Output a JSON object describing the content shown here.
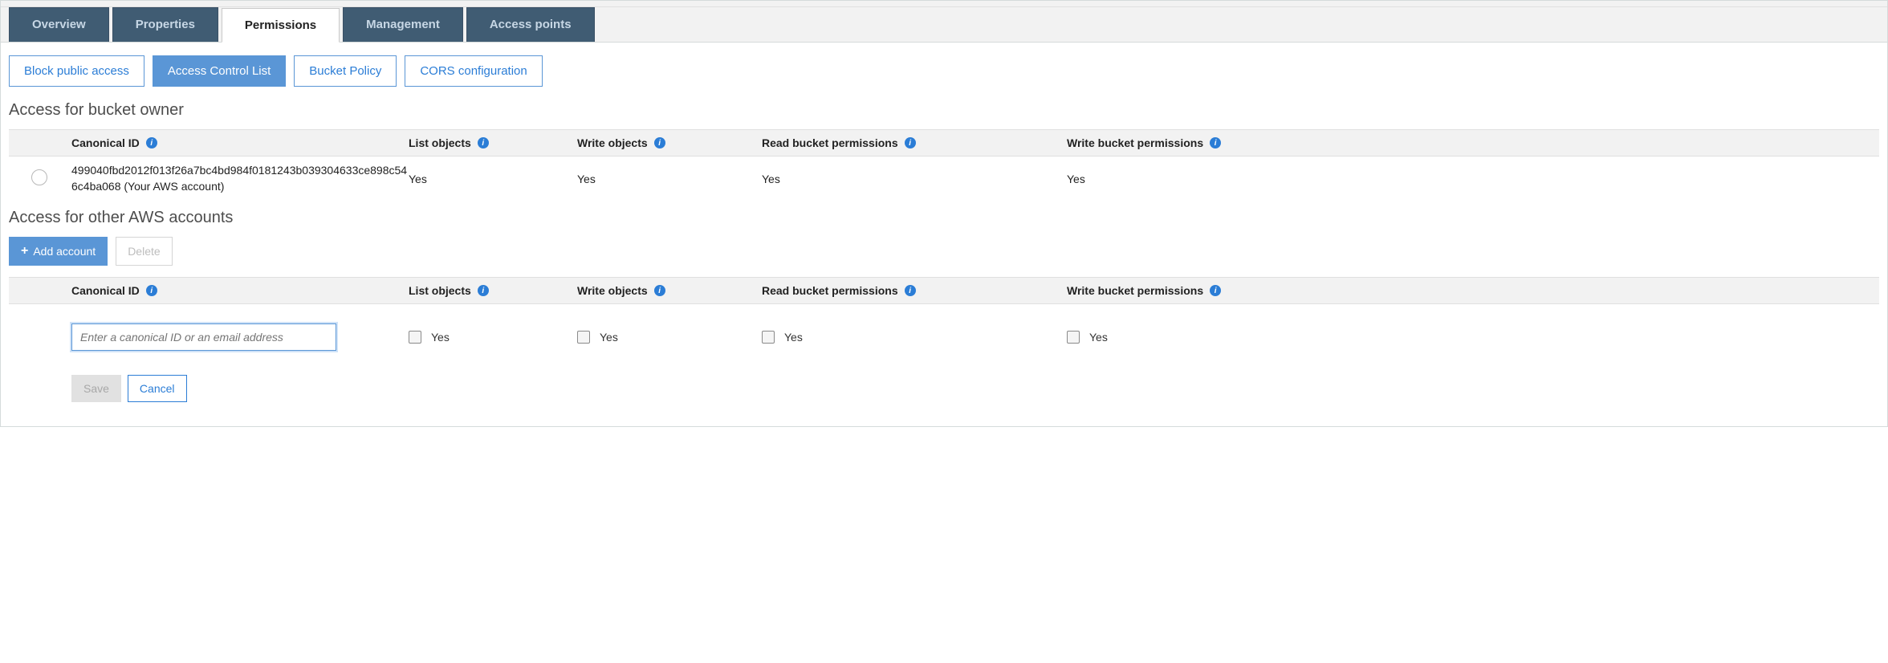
{
  "tabs": [
    "Overview",
    "Properties",
    "Permissions",
    "Management",
    "Access points"
  ],
  "activeTab": "Permissions",
  "subtabs": [
    "Block public access",
    "Access Control List",
    "Bucket Policy",
    "CORS configuration"
  ],
  "activeSubtab": "Access Control List",
  "ownerSection": {
    "title": "Access for bucket owner",
    "headers": [
      "Canonical ID",
      "List objects",
      "Write objects",
      "Read bucket permissions",
      "Write bucket permissions"
    ],
    "row": {
      "canonical": "499040fbd2012f013f26a7bc4bd984f0181243b039304633ce898c546c4ba068 (Your AWS account)",
      "list": "Yes",
      "write": "Yes",
      "read_perm": "Yes",
      "write_perm": "Yes"
    }
  },
  "otherSection": {
    "title": "Access for other AWS accounts",
    "addAccount": "Add account",
    "delete": "Delete",
    "headers": [
      "Canonical ID",
      "List objects",
      "Write objects",
      "Read bucket permissions",
      "Write bucket permissions"
    ],
    "inputPlaceholder": "Enter a canonical ID or an email address",
    "checkLabel": "Yes",
    "save": "Save",
    "cancel": "Cancel"
  }
}
